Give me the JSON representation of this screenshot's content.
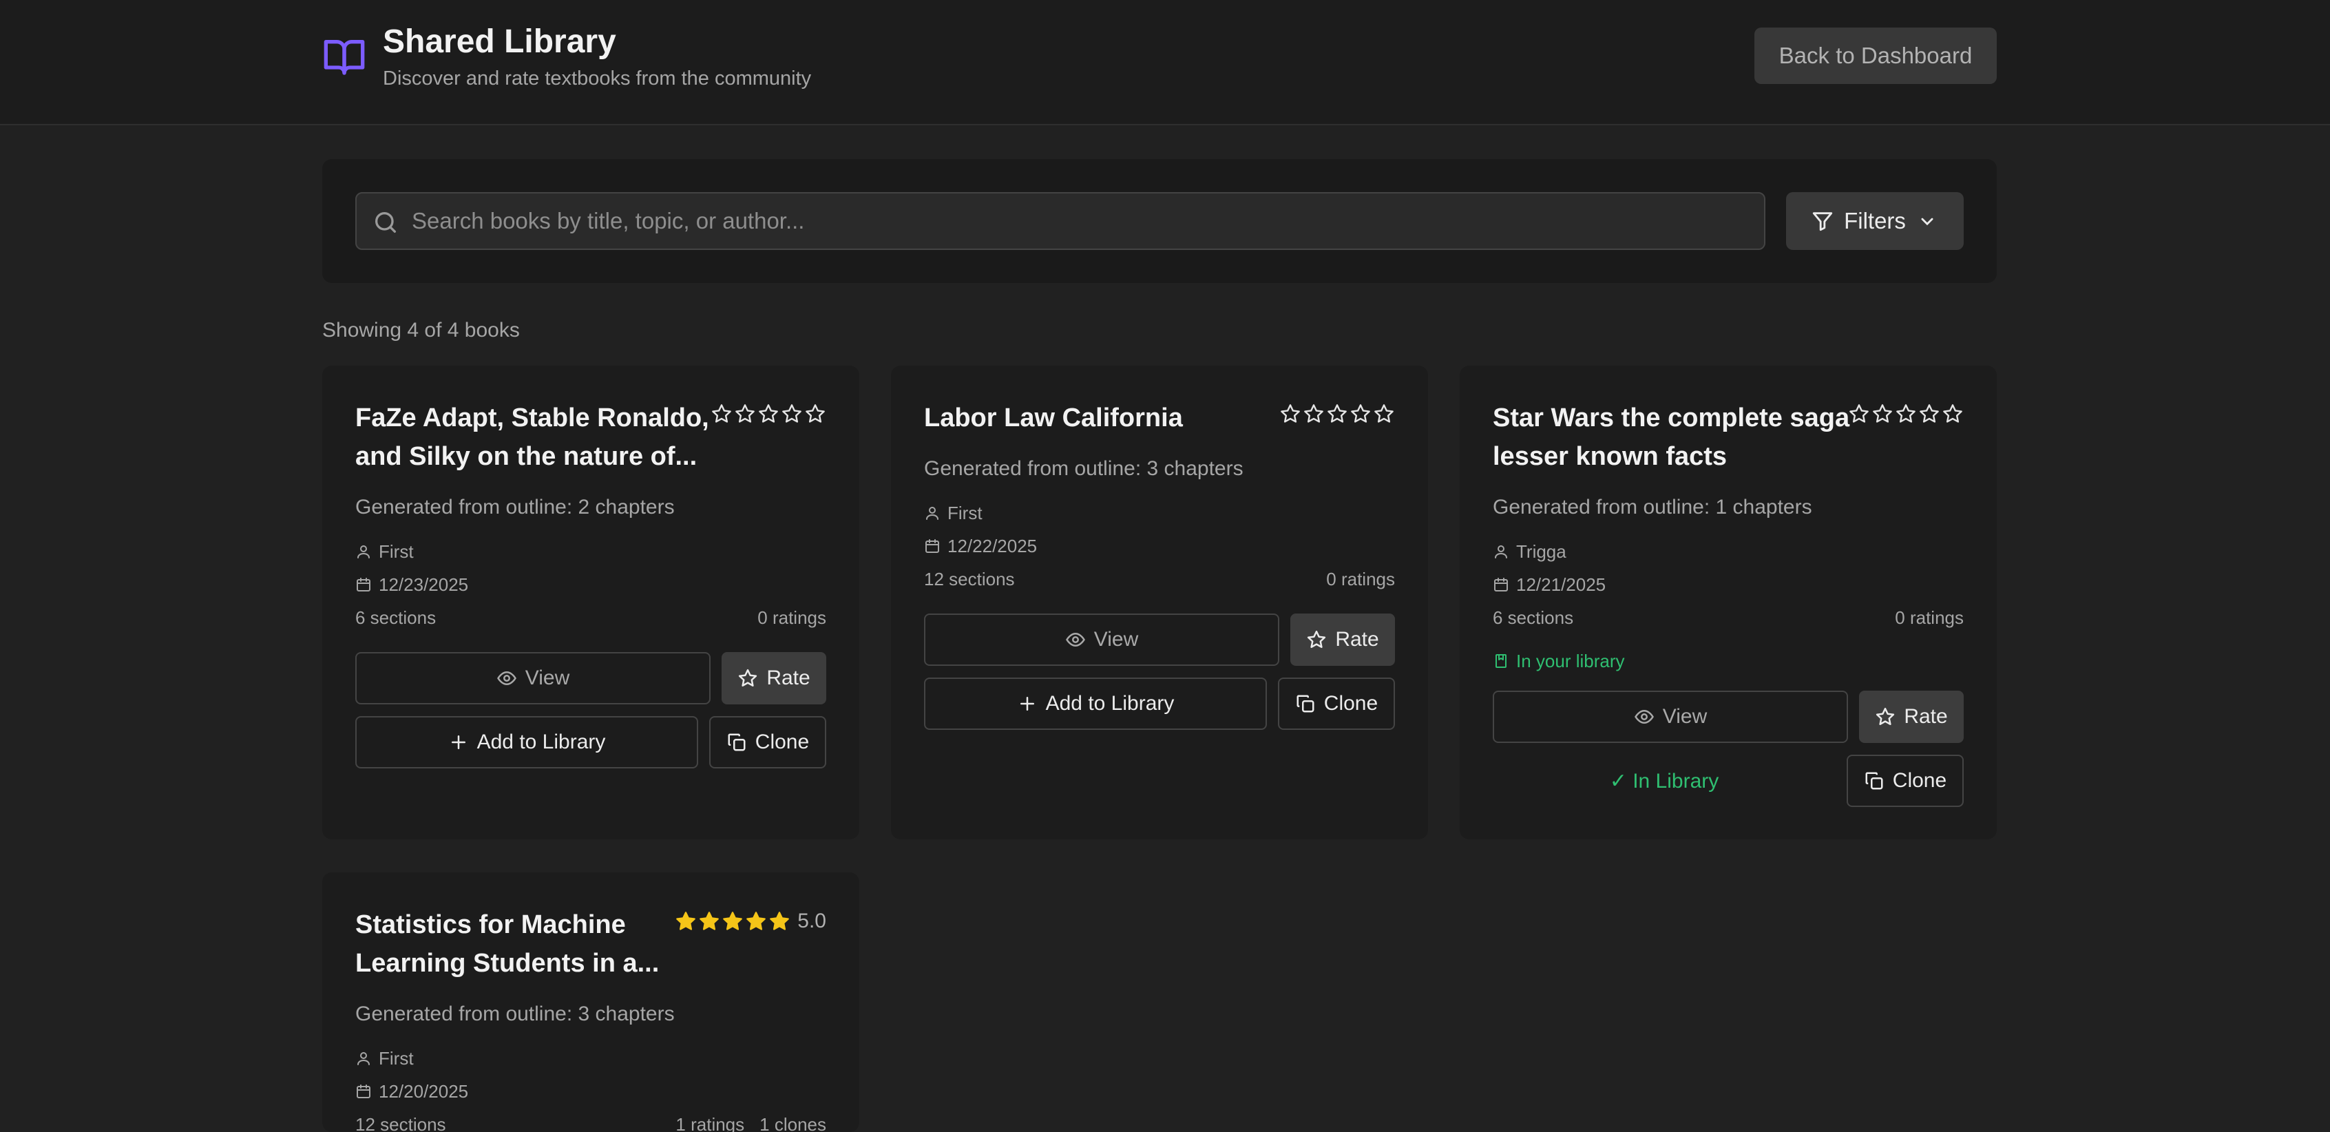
{
  "header": {
    "title": "Shared Library",
    "subtitle": "Discover and rate textbooks from the community",
    "back_button": "Back to Dashboard",
    "icon": "book-open-icon"
  },
  "search": {
    "placeholder": "Search books by title, topic, or author...",
    "value": "",
    "filters_label": "Filters"
  },
  "count_text": "Showing 4 of 4 books",
  "labels": {
    "view": "View",
    "rate": "Rate",
    "add_to_library": "Add to Library",
    "clone": "Clone",
    "in_your_library": "In your library",
    "in_library": "✓ In Library"
  },
  "colors": {
    "accent": "#7c5cff",
    "star_filled": "#f5c518",
    "success": "#2fbf71",
    "background": "#212121",
    "card": "#1c1c1c"
  },
  "books": [
    {
      "title": "FaZe Adapt, Stable Ronaldo, and Silky on the nature of...",
      "description": "Generated from outline: 2 chapters",
      "author": "First",
      "date": "12/23/2025",
      "sections": "6 sections",
      "ratings": "0 ratings",
      "clones": "",
      "rating": 0,
      "rating_text": "",
      "in_library": false
    },
    {
      "title": "Labor Law California",
      "description": "Generated from outline: 3 chapters",
      "author": "First",
      "date": "12/22/2025",
      "sections": "12 sections",
      "ratings": "0 ratings",
      "clones": "",
      "rating": 0,
      "rating_text": "",
      "in_library": false
    },
    {
      "title": "Star Wars the complete saga lesser known facts",
      "description": "Generated from outline: 1 chapters",
      "author": "Trigga",
      "date": "12/21/2025",
      "sections": "6 sections",
      "ratings": "0 ratings",
      "clones": "",
      "rating": 0,
      "rating_text": "",
      "in_library": true
    },
    {
      "title": "Statistics for Machine Learning Students in a...",
      "description": "Generated from outline: 3 chapters",
      "author": "First",
      "date": "12/20/2025",
      "sections": "12 sections",
      "ratings": "1 ratings",
      "clones": "1 clones",
      "rating": 5,
      "rating_text": "5.0",
      "in_library": false
    }
  ]
}
